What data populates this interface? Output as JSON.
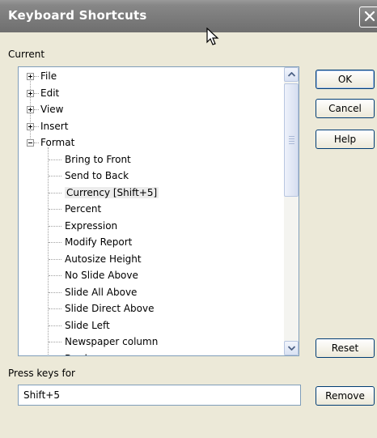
{
  "window": {
    "title": "Keyboard Shortcuts"
  },
  "labels": {
    "current": "Current",
    "press_keys": "Press keys for"
  },
  "tree": {
    "top_items": [
      "File",
      "Edit",
      "View",
      "Insert",
      "Format"
    ],
    "format_children": [
      "Bring to Front",
      "Send to Back",
      "Currency [Shift+5]",
      "Percent",
      "Expression",
      "Modify Report",
      "Autosize Height",
      "No Slide Above",
      "Slide All Above",
      "Slide Direct Above",
      "Slide Left",
      "Newspaper column",
      "Border"
    ],
    "selected": "Currency [Shift+5]"
  },
  "buttons": {
    "ok": "OK",
    "cancel": "Cancel",
    "help": "Help",
    "reset": "Reset",
    "remove": "Remove"
  },
  "input": {
    "value": "Shift+5"
  },
  "icons": {
    "close": "close-icon",
    "expand": "plus-box-icon",
    "collapse": "minus-box-icon",
    "cursor": "mouse-pointer-icon"
  }
}
